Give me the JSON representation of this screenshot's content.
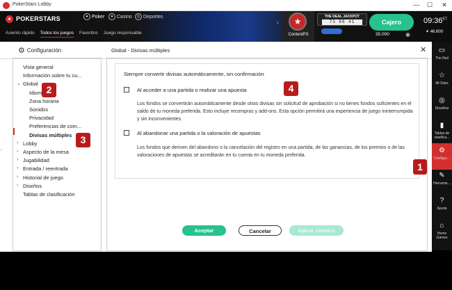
{
  "window": {
    "title": "PokerStars Lobby"
  },
  "topbar": {
    "logo_text": "POKERSTARS",
    "products": [
      {
        "label": "Poker",
        "icon": "spade-icon"
      },
      {
        "label": "Casino",
        "icon": "chip-icon"
      },
      {
        "label": "Deportes",
        "icon": "soccer-ball-icon"
      }
    ],
    "subnav": [
      "Asiento rápido",
      "Todos los juegos",
      "Favoritos",
      "Juego responsable"
    ],
    "subnav_active": "Todos los juegos",
    "contentps_label": "ContentPS",
    "jackpot_title": "THE DEAL JACKPOT",
    "jackpot_digits": "73 86 41",
    "cashier_label": "Cajero",
    "balance": "35.000",
    "clock": "09:36",
    "clock_zone": "ET",
    "points": "46.600"
  },
  "config": {
    "title": "Configuración",
    "panel_title": "Global - Divisas múltiples",
    "tree": [
      {
        "label": "Vista general",
        "level": 0
      },
      {
        "label": "Información sobre tu cu...",
        "level": 0
      },
      {
        "label": "Global",
        "level": 0,
        "arrow": "v"
      },
      {
        "label": "Idioma",
        "level": 1
      },
      {
        "label": "Zona horaria",
        "level": 1
      },
      {
        "label": "Sonidos",
        "level": 1
      },
      {
        "label": "Privacidad",
        "level": 1
      },
      {
        "label": "Preferencias de com...",
        "level": 1
      },
      {
        "label": "Divisas múltiples",
        "level": 1,
        "selected": true
      },
      {
        "label": "Lobby",
        "level": 0,
        "arrow": ">"
      },
      {
        "label": "Aspecto de la mesa",
        "level": 0,
        "arrow": ">"
      },
      {
        "label": "Jugabilidad",
        "level": 0,
        "arrow": ">"
      },
      {
        "label": "Entrada / reentrada",
        "level": 0,
        "arrow": ">"
      },
      {
        "label": "Historial de juego",
        "level": 0,
        "arrow": ">"
      },
      {
        "label": "Diseños",
        "level": 0,
        "arrow": ">"
      },
      {
        "label": "Tablas de clasificación",
        "level": 0
      }
    ],
    "heading": "Siempre convertir divisas automáticamente, sin confirmación",
    "option1_label": "Al acceder a una partida o realizar una apuesta",
    "option1_desc": "Los fondos se convertirán automáticamente desde otras divisas sin solicitud de aprobación si no tienes fondos suficientes en el saldo de tu moneda preferida. Esto incluye recompras y add-ons. Esta opción permitirá una experiencia de juego ininterrumpida y sin inconvenientes.",
    "option2_label": "Al abandonar una partida o la valoración de apuestas",
    "option2_desc": "Los fondos que deriven del abandono o la cancelación del registro en una partida, de las ganancias, de los premios o de las valoraciones de apuestas se acreditarán en tu cuenta en tu moneda preferida.",
    "accept_label": "Aceptar",
    "cancel_label": "Cancelar",
    "apply_label": "Aplicar cambios"
  },
  "rail": [
    {
      "label": "The Rail",
      "icon": "rail-icon"
    },
    {
      "label": "Mi Stars",
      "icon": "star-icon"
    },
    {
      "label": "Desafíos",
      "icon": "target-icon"
    },
    {
      "label": "Tablas de clasifica...",
      "icon": "bar-chart-icon"
    },
    {
      "label": "Configur...",
      "icon": "gear-icon",
      "active": true
    },
    {
      "label": "Herramie...",
      "icon": "wrench-icon"
    },
    {
      "label": "Ayuda",
      "icon": "help-icon"
    },
    {
      "label": "Home Games",
      "icon": "home-icon"
    }
  ],
  "annotations": [
    "1",
    "2",
    "3",
    "4"
  ],
  "colors": {
    "accent": "#27c28f",
    "brand": "#d32f2f",
    "badge": "#b71c1c"
  }
}
